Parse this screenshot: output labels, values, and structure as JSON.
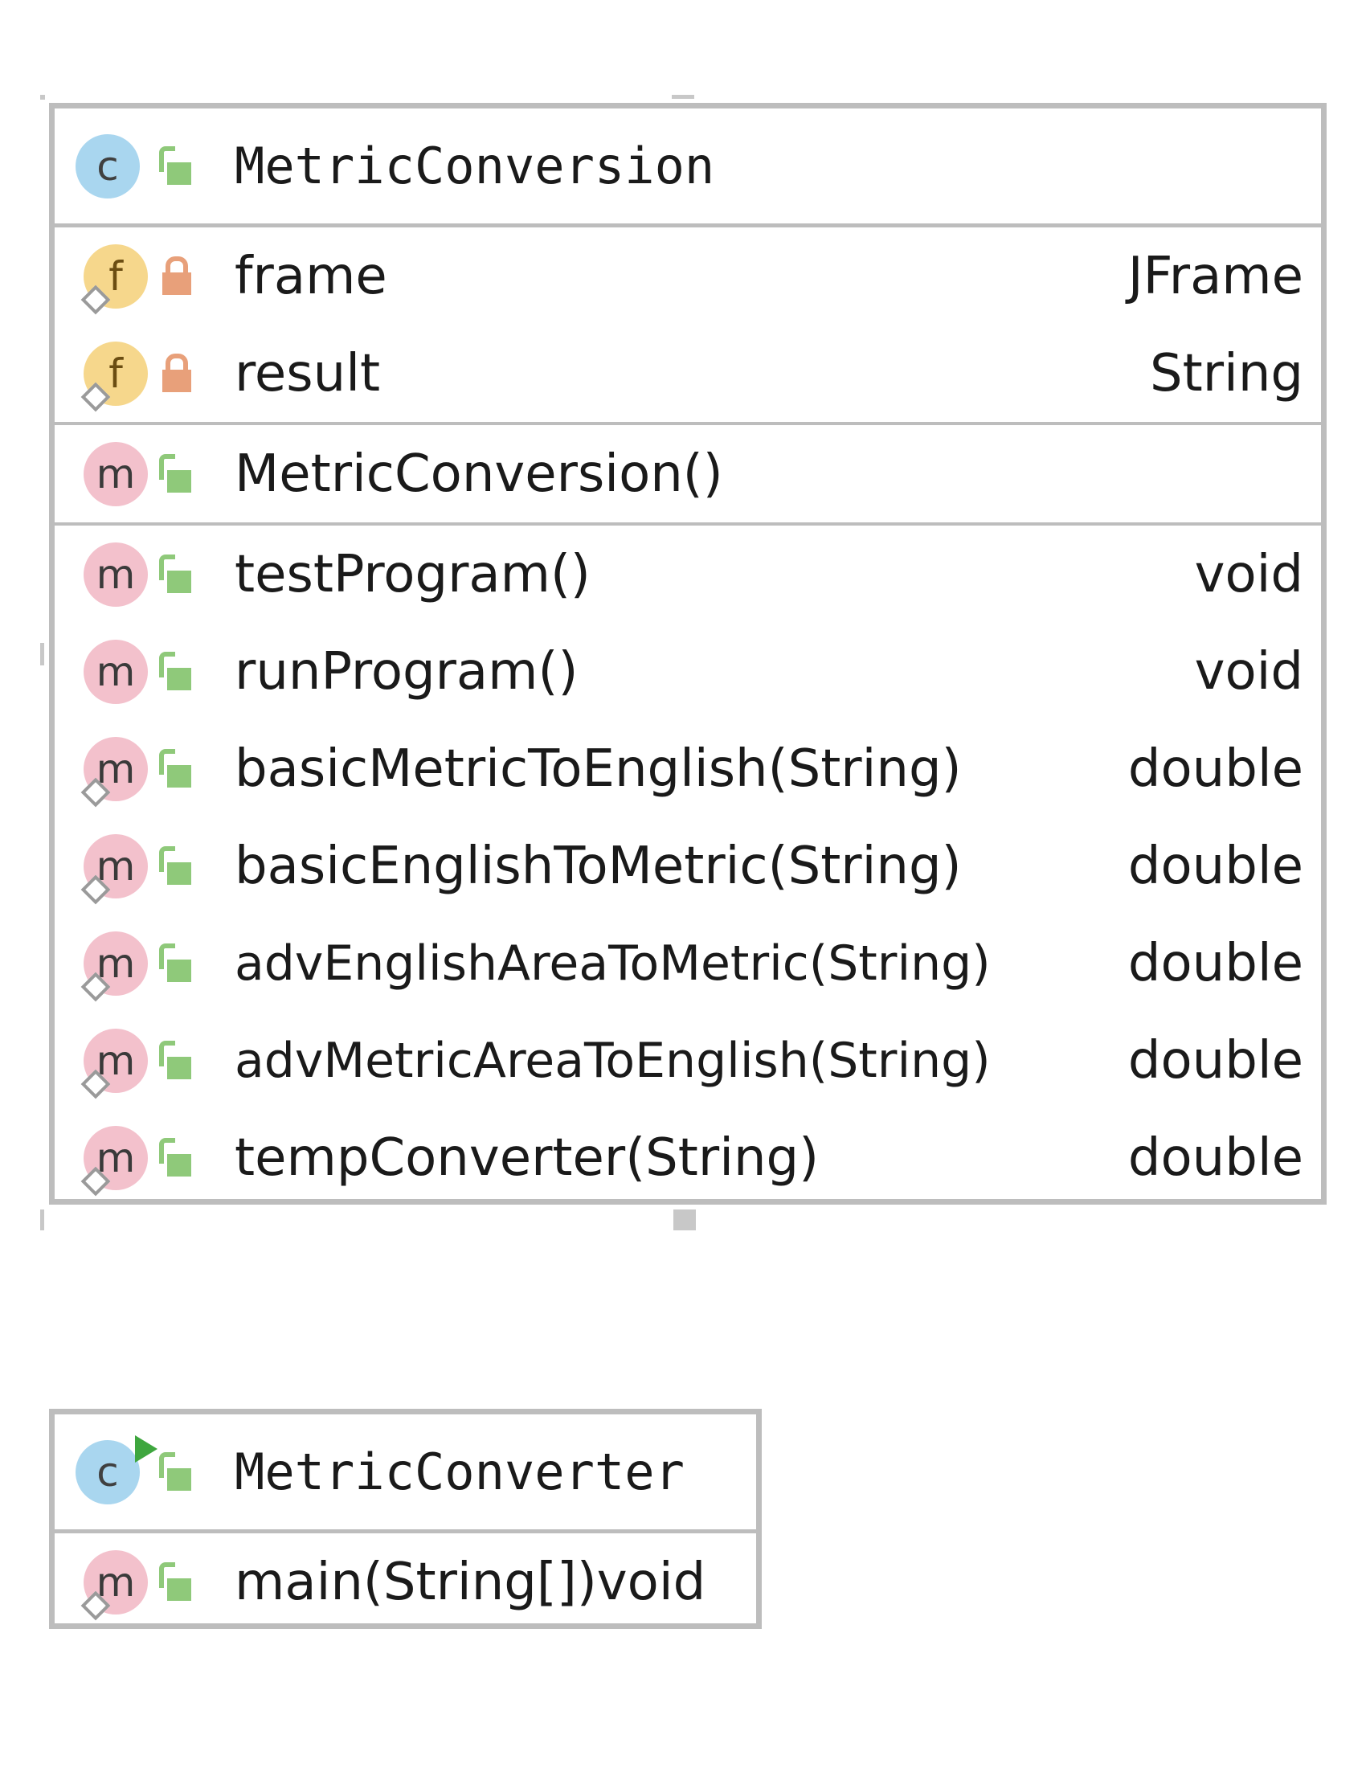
{
  "classes": [
    {
      "name": "MetricConversion",
      "fields": [
        {
          "name": "frame",
          "type": "JFrame"
        },
        {
          "name": "result",
          "type": "String"
        }
      ],
      "constructors": [
        {
          "name": "MetricConversion()"
        }
      ],
      "methods": [
        {
          "name": "testProgram()",
          "type": "void"
        },
        {
          "name": "runProgram()",
          "type": "void"
        },
        {
          "name": "basicMetricToEnglish(String)",
          "type": "double"
        },
        {
          "name": "basicEnglishToMetric(String)",
          "type": "double"
        },
        {
          "name": "advEnglishAreaToMetric(String)",
          "type": "double"
        },
        {
          "name": "advMetricAreaToEnglish(String)",
          "type": "double"
        },
        {
          "name": "tempConverter(String)",
          "type": "double"
        }
      ]
    },
    {
      "name": "MetricConverter",
      "methods": [
        {
          "name": "main(String[])",
          "type": "void"
        }
      ]
    }
  ],
  "icons": {
    "class": "class-icon",
    "field": "field-icon",
    "method": "method-icon",
    "public": "unlocked-icon",
    "private": "lock-icon"
  },
  "colors": {
    "border": "#bdbdbd",
    "class_icon": "#a9d6ef",
    "field_icon": "#f6d78c",
    "method_icon": "#f3c1cc",
    "public": "#8fc97a",
    "private": "#e8a07a",
    "runnable": "#3ea63e"
  }
}
